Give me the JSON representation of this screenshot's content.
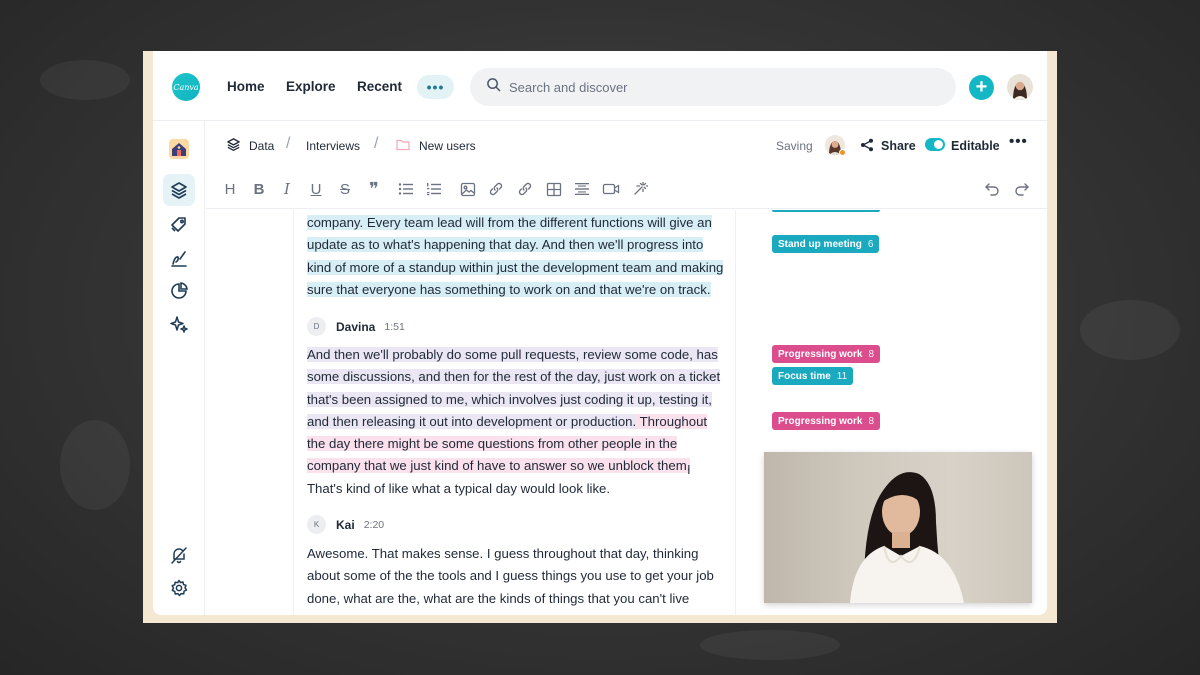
{
  "nav": {
    "logo_text": "Canva",
    "home": "Home",
    "explore": "Explore",
    "recent": "Recent",
    "more": "•••",
    "add": "+"
  },
  "search": {
    "placeholder": "Search and discover"
  },
  "breadcrumb": {
    "items": [
      "Data",
      "Interviews",
      "New users"
    ],
    "separator": "/"
  },
  "status": {
    "saving": "Saving",
    "share": "Share",
    "editable": "Editable",
    "editable_on": true,
    "more": "•••"
  },
  "toolbar": {
    "heading": "H",
    "bold": "B",
    "italic": "I",
    "underline": "U",
    "strike": "S",
    "quote": "❞"
  },
  "transcript": {
    "block1": {
      "lines": [
        "company. Every team lead will from the different functions will give an",
        "update as to what's happening that day. And then we'll progress into",
        "kind of more of a standup within just the development team and making",
        "sure that everyone has something to work on and that we're on track."
      ]
    },
    "speaker2": {
      "initial": "D",
      "name": "Davina",
      "time": "1:51"
    },
    "block2": {
      "lines": [
        "And then we'll probably do some pull requests, review some code, has",
        "some discussions, and then for the rest of the day, just work on a ticket",
        "that's been assigned to me, which involves just coding it up, testing it,",
        "and then releasing it out into development or production.",
        " Throughout",
        "the day there might be some questions from other people in the",
        "company that we just kind of have to answer so we unblock them.",
        "That's kind of like what a typical day would look like."
      ]
    },
    "speaker3": {
      "initial": "K",
      "name": "Kai",
      "time": "2:20"
    },
    "block3": {
      "lines": [
        "Awesome. That makes sense. I guess throughout that day, thinking",
        "about some of the the tools and I guess things you use to get your job",
        "done, what are the, what are the kinds of things that you can't live"
      ]
    }
  },
  "tags": [
    {
      "label": "Stand up meeting",
      "count": "6",
      "color": "#1aa9bf"
    },
    {
      "label": "Progressing work",
      "count": "8",
      "color": "#dc4d8e"
    },
    {
      "label": "Focus time",
      "count": "11",
      "color": "#1aa9bf"
    },
    {
      "label": "Progressing work",
      "count": "8",
      "color": "#dc4d8e"
    }
  ],
  "colors": {
    "accent": "#14b8c4",
    "highlight_teal": "#d7eef5",
    "highlight_purple": "#ebe6f3",
    "highlight_pink": "#fbe1ec"
  },
  "icons": {
    "rail": [
      "workspace-home-icon",
      "layers-icon",
      "tag-icon",
      "signature-icon",
      "pie-chart-icon",
      "sparkles-icon",
      "bell-off-icon",
      "settings-icon"
    ],
    "toolbar": [
      "heading-icon",
      "bold-icon",
      "italic-icon",
      "underline-icon",
      "strikethrough-icon",
      "quote-icon",
      "bullet-list-icon",
      "numbered-list-icon",
      "image-icon",
      "link-icon",
      "link-icon",
      "table-icon",
      "divider-icon",
      "video-icon",
      "magic-wand-icon",
      "undo-icon",
      "redo-icon"
    ]
  }
}
